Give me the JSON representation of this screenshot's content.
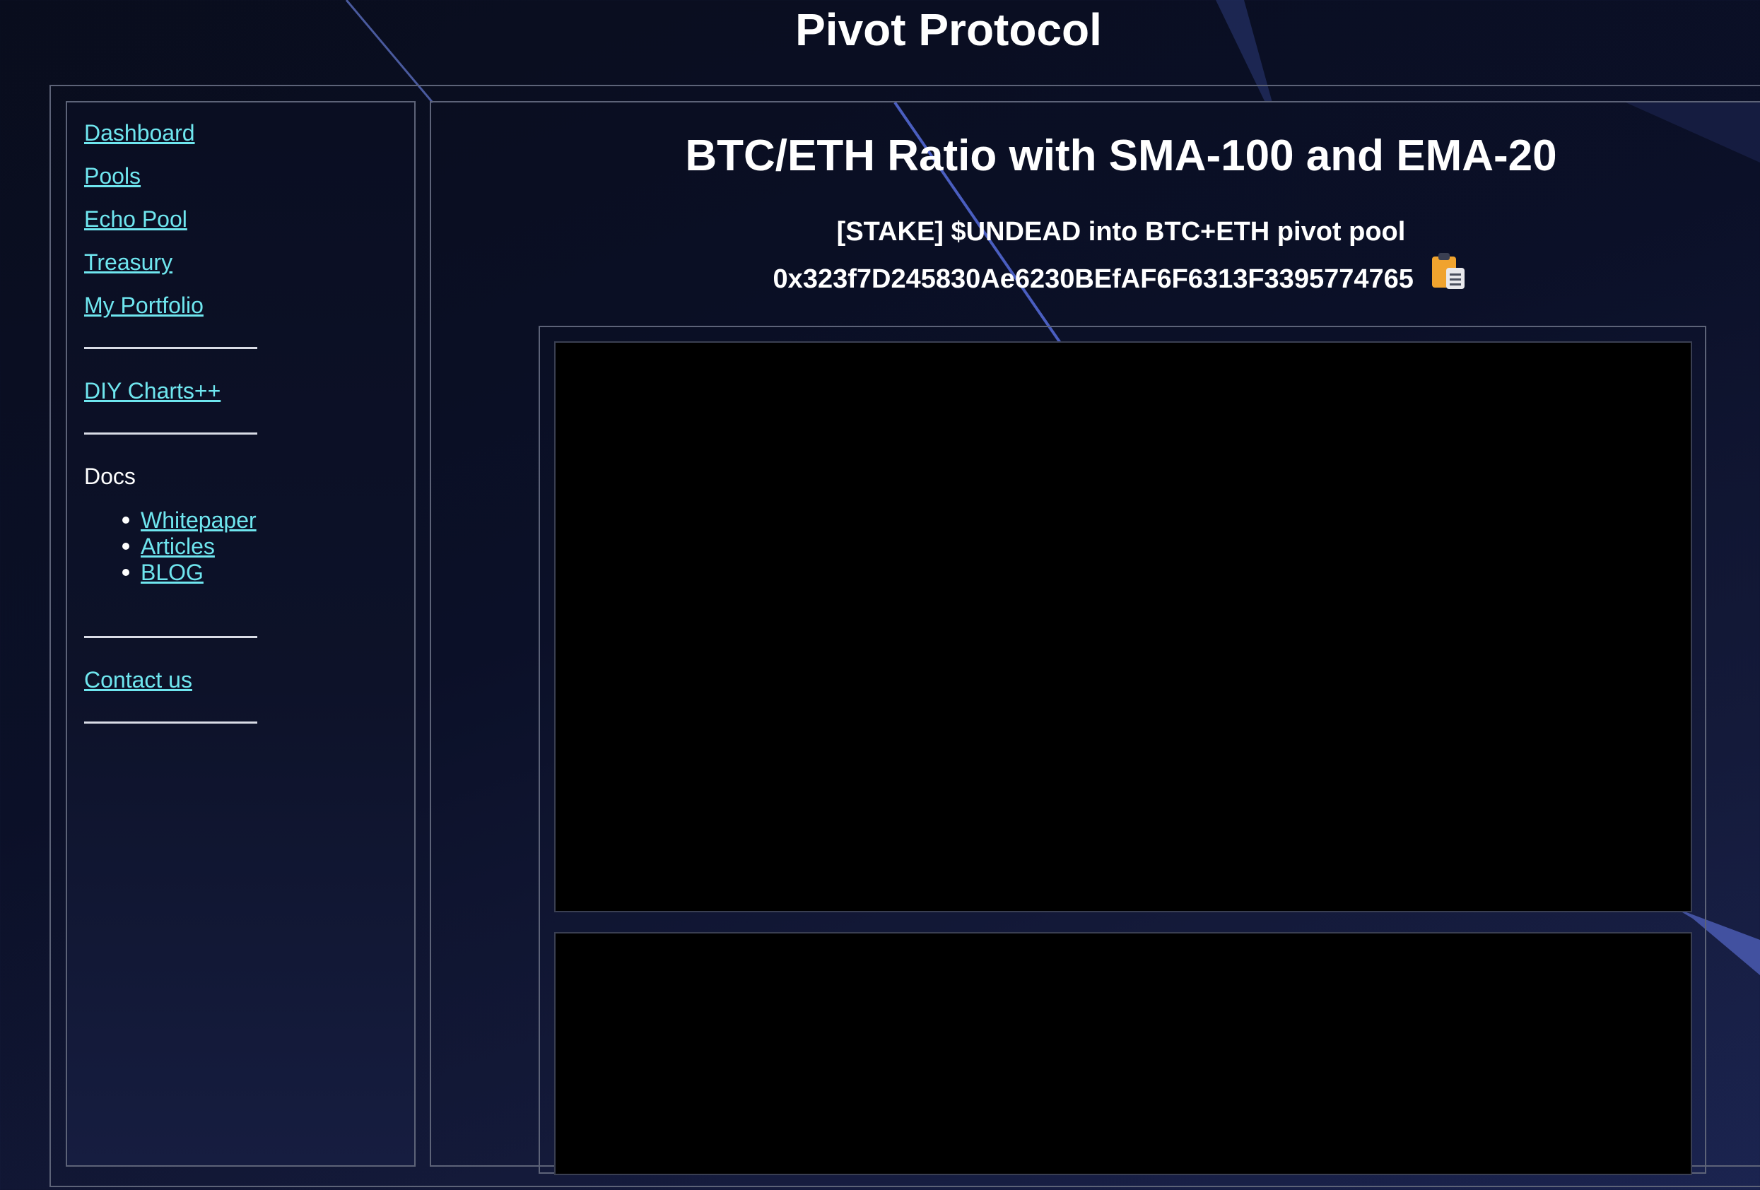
{
  "header": {
    "title": "Pivot Protocol"
  },
  "sidebar": {
    "nav_links": [
      {
        "label": "Dashboard"
      },
      {
        "label": "Pools"
      },
      {
        "label": "Echo Pool"
      },
      {
        "label": "Treasury"
      },
      {
        "label": "My Portfolio"
      }
    ],
    "diy_link": "DIY Charts++",
    "docs": {
      "label": "Docs",
      "items": [
        {
          "label": "Whitepaper"
        },
        {
          "label": "Articles"
        },
        {
          "label": "BLOG"
        }
      ]
    },
    "contact_link": "Contact us"
  },
  "main": {
    "heading": "BTC/ETH Ratio with SMA-100 and EMA-20",
    "stake_text": "[STAKE] $UNDEAD into BTC+ETH pivot pool",
    "contract_address": "0x323f7D245830Ae6230BEfAF6F6313F3395774765",
    "copy_icon": "clipboard-icon"
  },
  "colors": {
    "link": "#6fe6ef",
    "background": "#0b1028",
    "border": "#5d6378",
    "chart_background": "#000000",
    "clipboard": "#f0a32e"
  }
}
